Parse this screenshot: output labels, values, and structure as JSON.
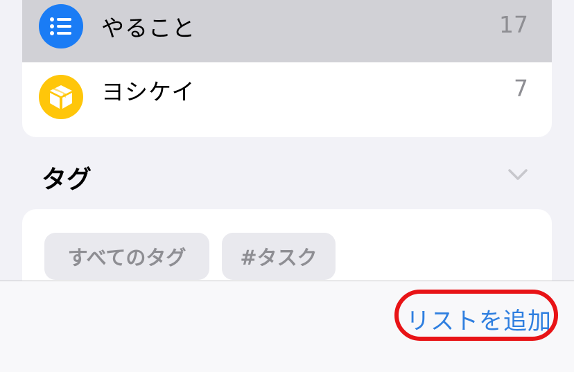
{
  "lists": [
    {
      "label": "やること",
      "count": "17",
      "icon": "list-bullet-icon",
      "color": "#1a7cf5",
      "selected": true
    },
    {
      "label": "ヨシケイ",
      "count": "7",
      "icon": "box-icon",
      "color": "#ffc60a",
      "selected": false
    }
  ],
  "tags_section": {
    "title": "タグ",
    "chevron": "chevron-down-icon",
    "chips": [
      "すべてのタグ",
      "#タスク"
    ]
  },
  "toolbar": {
    "add_list_label": "リストを追加",
    "highlight_color": "#e81316",
    "accent": "#2f7fe0"
  }
}
